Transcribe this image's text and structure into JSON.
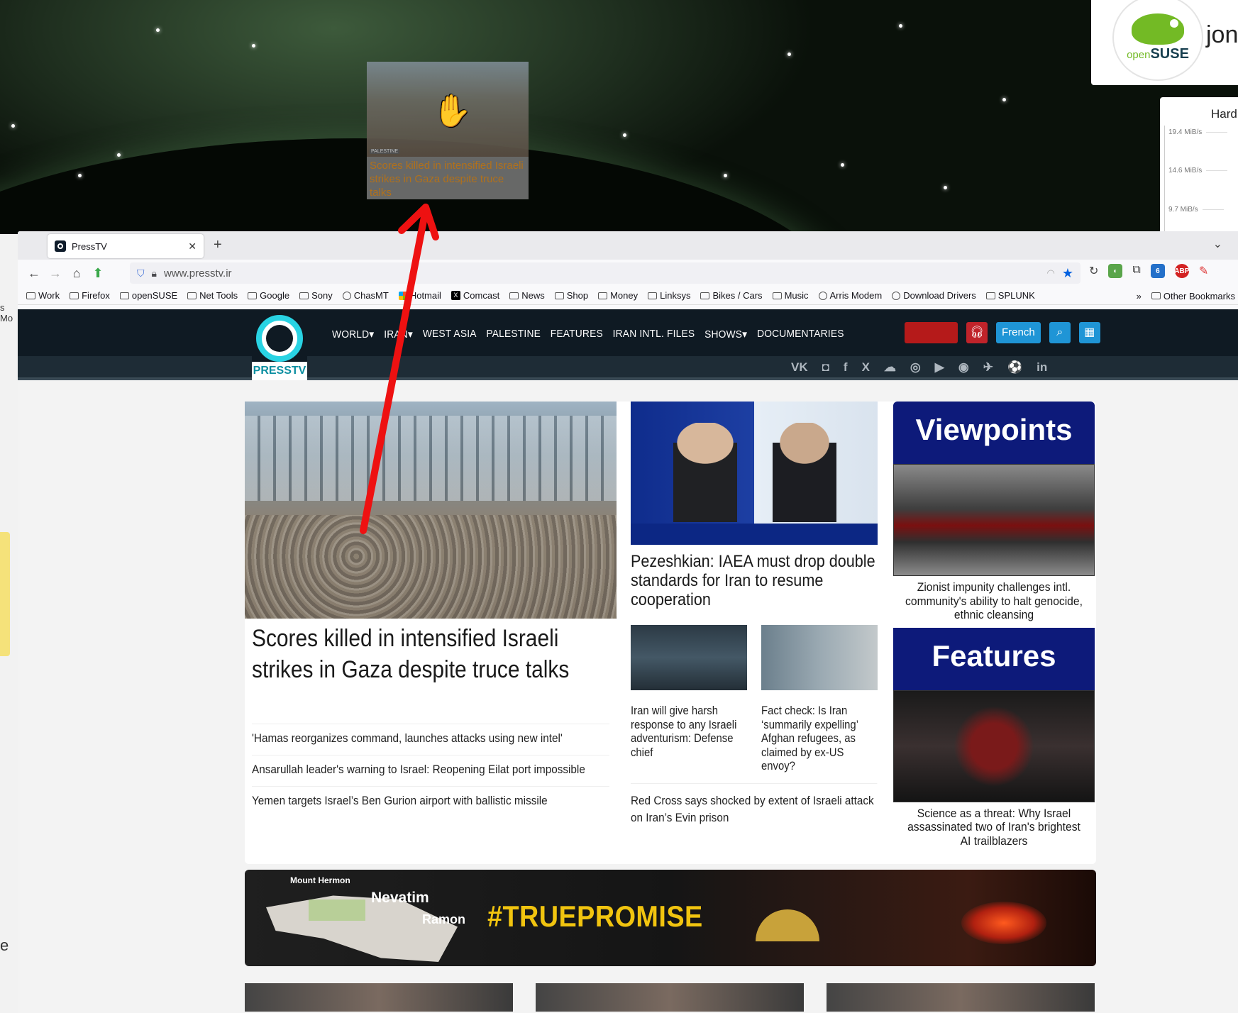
{
  "desktop": {
    "widget_user": "jon",
    "suse_logo": "openSUSE",
    "suse_open": "open",
    "suse_suse": "SUSE",
    "hd_title": "Hard",
    "hd_lines": [
      "19.4 MiB/s",
      "14.6 MiB/s",
      "9.7 MiB/s"
    ],
    "left_labels": [
      "s Mo",
      "e"
    ],
    "drag_caption": "Scores killed in intensified Israeli strikes in Gaza despite truce talks",
    "drag_tag": "PALESTINE"
  },
  "browser": {
    "tab_title": "PressTV",
    "url": "www.presstv.ir",
    "bookmarks": [
      "Work",
      "Firefox",
      "openSUSE",
      "Net Tools",
      "Google",
      "Sony",
      "ChasMT",
      "Hotmail",
      "Comcast",
      "News",
      "Shop",
      "Money",
      "Linksys",
      "Bikes / Cars",
      "Music",
      "Arris Modem",
      "Download Drivers",
      "SPLUNK"
    ],
    "other_bookmarks": "Other Bookmarks",
    "ext_badge": "6"
  },
  "site": {
    "logo_text": "PRESSTV",
    "nav": [
      "WORLD▾",
      "IRAN▾",
      "WEST ASIA",
      "PALESTINE",
      "FEATURES",
      "IRAN INTL. FILES",
      "SHOWS▾",
      "DOCUMENTARIES"
    ],
    "lang_button": "French",
    "social": [
      "VK",
      "◘",
      "f",
      "X",
      "☁",
      "◎",
      "▶",
      "◉",
      "✈",
      "⚽",
      "in"
    ]
  },
  "main": {
    "hero_title": "Scores killed in intensified Israeli strikes in Gaza despite truce talks",
    "hero_links": [
      "'Hamas reorganizes command, launches attacks using new intel'",
      "Ansarullah leader's warning to Israel: Reopening Eilat port impossible",
      "Yemen targets Israel’s Ben Gurion airport with ballistic missile"
    ],
    "mid_title": "Pezeshkian: IAEA must drop double standards for Iran to resume cooperation",
    "mini": [
      "Iran will give harsh response to any Israeli adventurism: Defense chief",
      "Fact check: Is Iran ‘summarily expelling’ Afghan refugees, as claimed by ex-US envoy?"
    ],
    "mid_bottom": "Red Cross says shocked by extent of Israeli attack on Iran’s Evin prison",
    "viewpoints_label": "Viewpoints",
    "viewpoints_title": "Zionist impunity challenges intl. community's ability to halt genocide, ethnic cleansing",
    "features_label": "Features",
    "features_title": "Science as a threat: Why Israel assassinated two of Iran's brightest AI trailblazers",
    "promo": {
      "hashtag": "#TRUEPROMISE",
      "labels": [
        "Mount Hermon",
        "Nevatim",
        "Ramon"
      ]
    }
  },
  "colors": {
    "accent_blue": "#1f95d6",
    "site_dark": "#0f1a23",
    "arrow_red": "#ee1111",
    "hashtag_yellow": "#f1c40f"
  }
}
